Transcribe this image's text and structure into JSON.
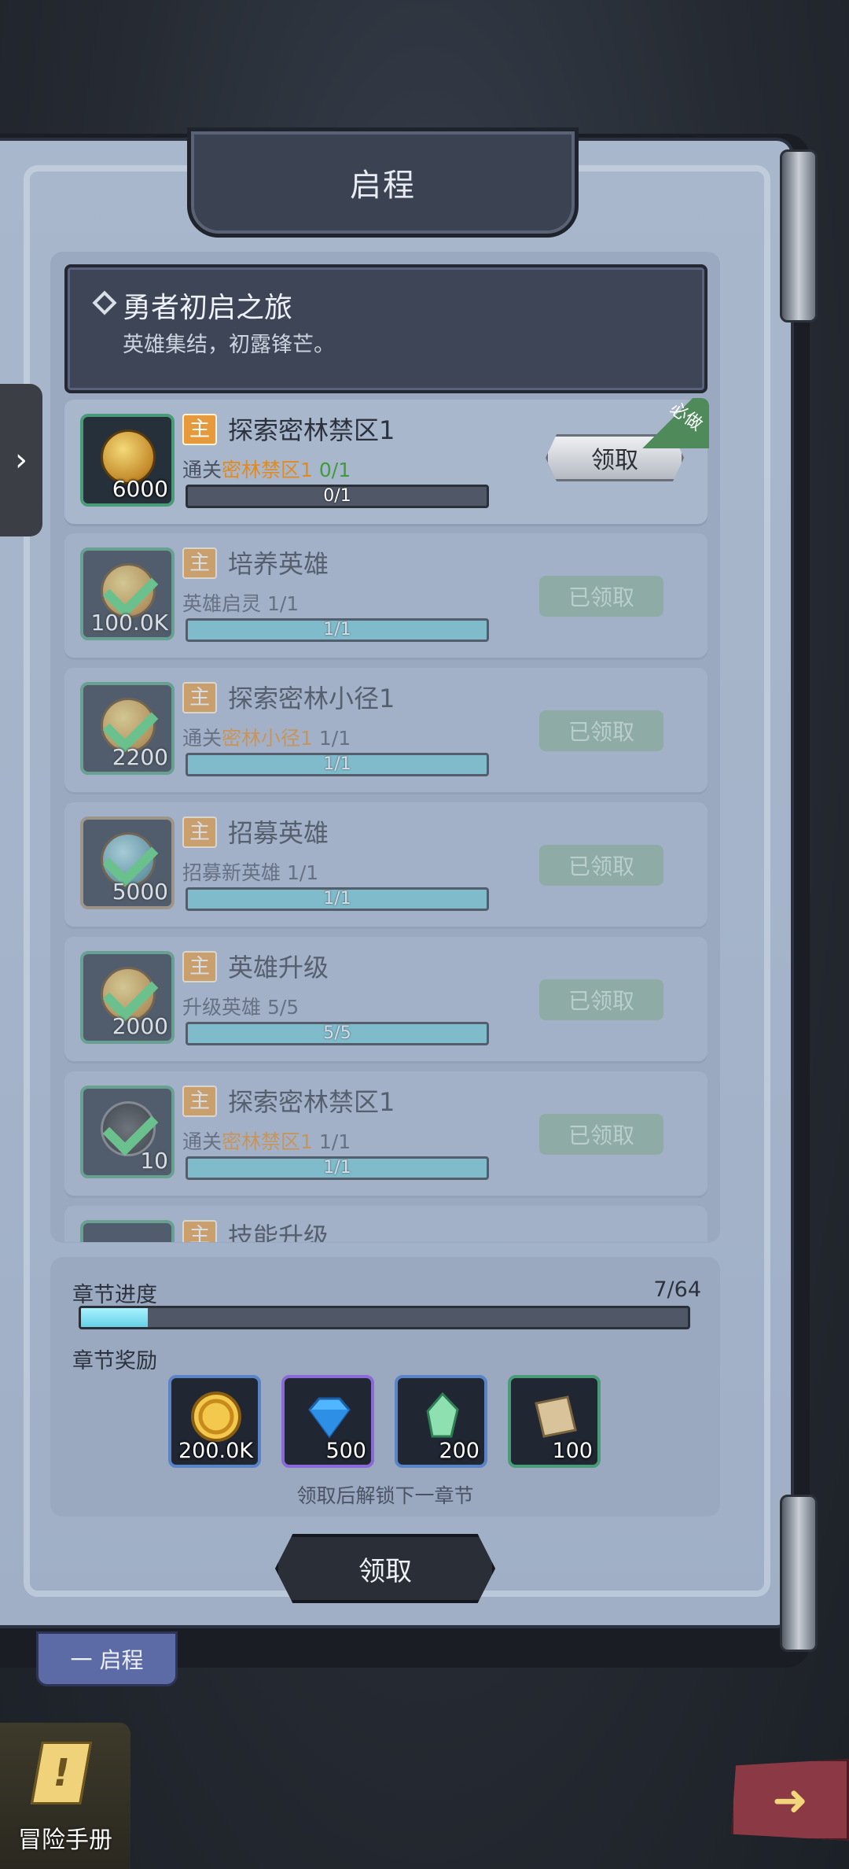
{
  "header": {
    "title": "启程"
  },
  "chapter": {
    "name": "勇者初启之旅",
    "desc": "英雄集结，初露锋芒。"
  },
  "tasks": [
    {
      "tag": "主",
      "title": "探索密林禁区1",
      "sub_prefix": "通关",
      "sub_highlight": "密林禁区1",
      "sub_suffix": "0/1",
      "progress_text": "0/1",
      "progress": 0,
      "amount": "6000",
      "state": "claim",
      "claim_label": "领取",
      "must_label": "必做"
    },
    {
      "tag": "主",
      "title": "培养英雄",
      "sub_prefix": "英雄启灵 1/1",
      "sub_highlight": "",
      "sub_suffix": "",
      "progress_text": "1/1",
      "progress": 1,
      "amount": "100.0K",
      "state": "claimed",
      "claim_label": "已领取"
    },
    {
      "tag": "主",
      "title": "探索密林小径1",
      "sub_prefix": "通关",
      "sub_highlight": "密林小径1",
      "sub_suffix": "1/1",
      "progress_text": "1/1",
      "progress": 1,
      "amount": "2200",
      "state": "claimed",
      "claim_label": "已领取"
    },
    {
      "tag": "主",
      "title": "招募英雄",
      "sub_prefix": "招募新英雄 1/1",
      "sub_highlight": "",
      "sub_suffix": "",
      "progress_text": "1/1",
      "progress": 1,
      "amount": "5000",
      "state": "claimed",
      "claim_label": "已领取"
    },
    {
      "tag": "主",
      "title": "英雄升级",
      "sub_prefix": "升级英雄 5/5",
      "sub_highlight": "",
      "sub_suffix": "",
      "progress_text": "5/5",
      "progress": 1,
      "amount": "2000",
      "state": "claimed",
      "claim_label": "已领取"
    },
    {
      "tag": "主",
      "title": "探索密林禁区1",
      "sub_prefix": "通关",
      "sub_highlight": "密林禁区1",
      "sub_suffix": "1/1",
      "progress_text": "1/1",
      "progress": 1,
      "amount": "10",
      "state": "claimed",
      "claim_label": "已领取"
    },
    {
      "tag": "主",
      "title": "技能升级"
    }
  ],
  "chapter_progress": {
    "label": "章节进度",
    "count": "7/64",
    "progress": 0.11,
    "reward_label": "章节奖励",
    "rewards": [
      {
        "name": "gold-coin-icon",
        "amount": "200.0K",
        "color": "#5b84c6"
      },
      {
        "name": "diamond-icon",
        "amount": "500",
        "color": "#8a6ad6"
      },
      {
        "name": "crystal-icon",
        "amount": "200",
        "color": "#5b84c6"
      },
      {
        "name": "scroll-icon",
        "amount": "100",
        "color": "#4a9b77"
      }
    ],
    "unlock_hint": "领取后解锁下一章节",
    "claim_label": "领取"
  },
  "bookmark": {
    "label": "一 启程"
  },
  "manual": {
    "label": "冒险手册"
  },
  "side_tab": {
    "icon": "chevron-right-icon"
  },
  "next_btn": {
    "icon": "arrow-right-icon"
  }
}
